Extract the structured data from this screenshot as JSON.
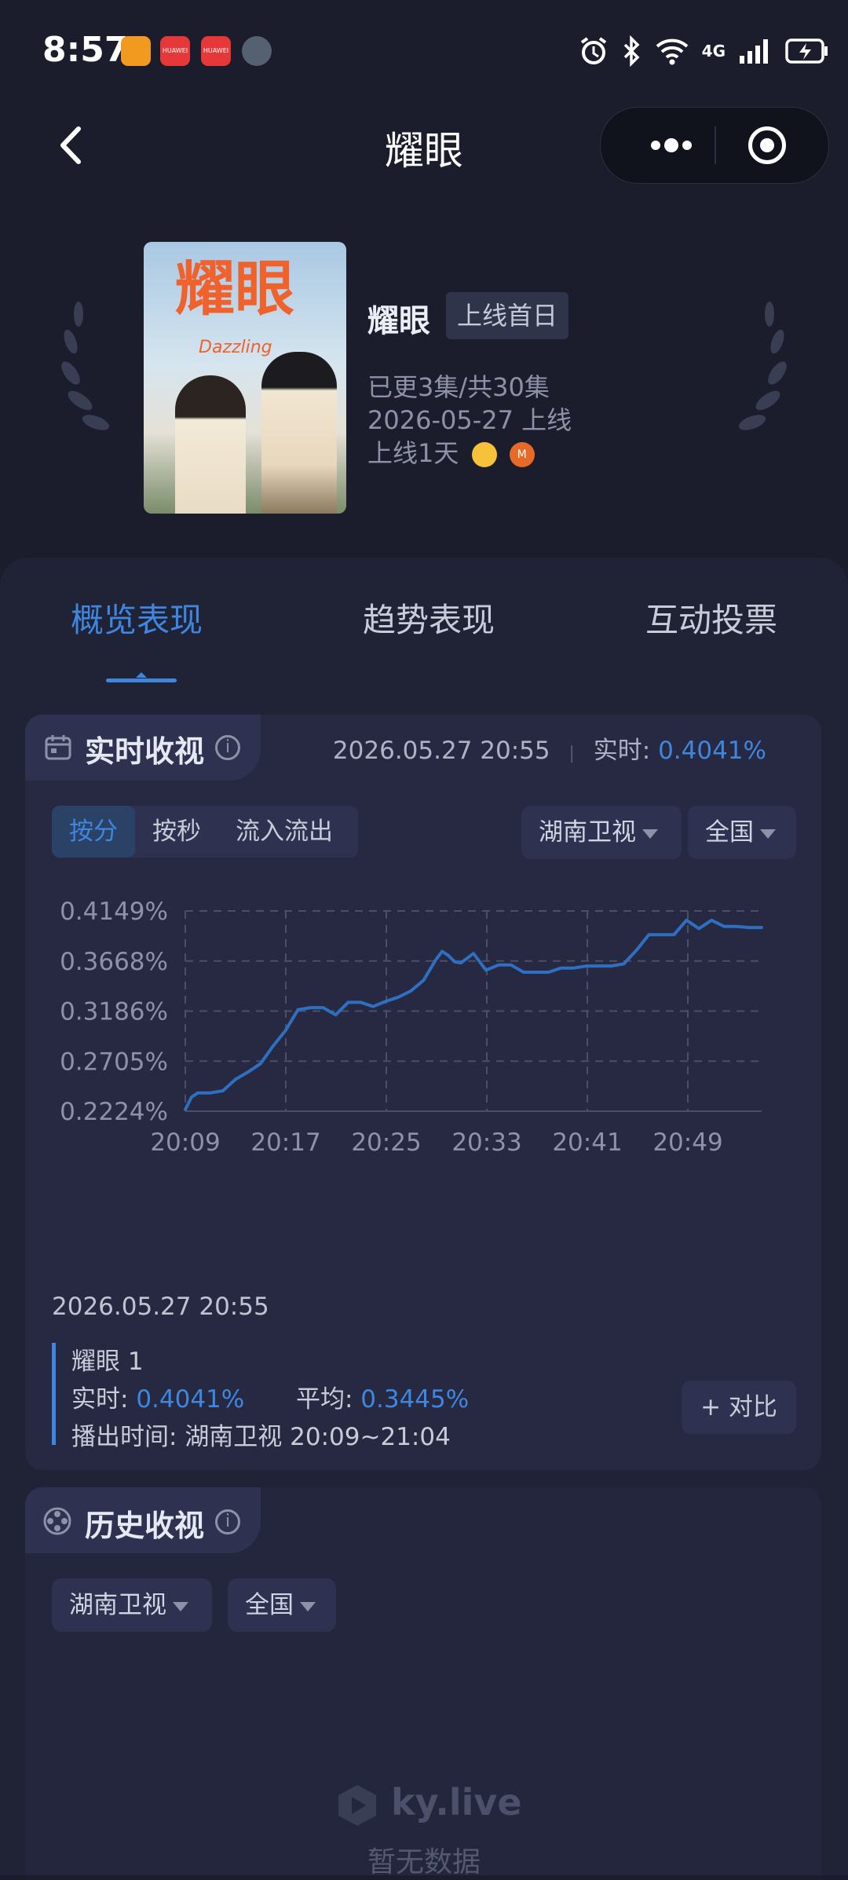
{
  "status_bar": {
    "time": "8:57",
    "apps": [
      {
        "icon": "taobao-app-icon",
        "color": "#f29a20",
        "label": ""
      },
      {
        "icon": "huawei-app-icon",
        "color": "#e63838",
        "label": "HUAWEI"
      },
      {
        "icon": "huawei-app-icon-2",
        "color": "#e63838",
        "label": "HUAWEI"
      },
      {
        "icon": "avatar-app-icon",
        "color": "#556070",
        "label": ""
      }
    ],
    "network": "4G"
  },
  "nav": {
    "title": "耀眼"
  },
  "show": {
    "title": "耀眼",
    "badge": "上线首日",
    "episodes": "已更3集/共30集",
    "air_date": "2026-05-27 上线",
    "days_online": "上线1天",
    "poster_title": "耀眼",
    "poster_subtitle": "Dazzling"
  },
  "tabs": [
    {
      "label": "概览表现",
      "active": true
    },
    {
      "label": "趋势表现",
      "active": false
    },
    {
      "label": "互动投票",
      "active": false
    }
  ],
  "realtime": {
    "title": "实时收视",
    "info": "i",
    "timestamp": "2026.05.27 20:55",
    "live_label": "实时:",
    "live_value": "0.4041%",
    "modes": [
      "按分",
      "按秒",
      "流入流出"
    ],
    "channel": "湖南卫视",
    "region": "全国"
  },
  "chart_data": {
    "type": "line",
    "y_ticks": [
      "0.4149%",
      "0.3668%",
      "0.3186%",
      "0.2705%",
      "0.2224%"
    ],
    "x_ticks": [
      "20:09",
      "20:17",
      "20:25",
      "20:33",
      "20:41",
      "20:49"
    ],
    "ylim": [
      0.2224,
      0.4149
    ],
    "xlim_minutes": [
      0,
      46
    ],
    "grid": true,
    "color": "#2f6fc2",
    "series": [
      {
        "x": [
          0,
          0.5,
          1,
          2,
          3,
          4,
          5,
          6,
          7,
          8,
          9,
          10,
          11,
          12,
          13,
          14,
          15,
          16,
          17,
          18,
          19,
          20,
          20.5,
          21,
          21.5,
          22,
          23,
          24,
          25,
          26,
          27,
          28,
          29,
          30,
          31,
          32,
          33,
          34,
          35,
          36,
          37,
          38,
          39,
          40,
          41,
          42,
          43,
          44,
          45,
          46
        ],
        "y": [
          0.224,
          0.236,
          0.24,
          0.24,
          0.242,
          0.253,
          0.26,
          0.268,
          0.285,
          0.3,
          0.32,
          0.322,
          0.322,
          0.315,
          0.327,
          0.327,
          0.323,
          0.328,
          0.332,
          0.338,
          0.348,
          0.368,
          0.376,
          0.372,
          0.366,
          0.365,
          0.374,
          0.358,
          0.363,
          0.363,
          0.356,
          0.356,
          0.356,
          0.36,
          0.36,
          0.362,
          0.362,
          0.362,
          0.364,
          0.377,
          0.392,
          0.392,
          0.392,
          0.406,
          0.398,
          0.406,
          0.4,
          0.4,
          0.399,
          0.399
        ]
      }
    ]
  },
  "legend": {
    "date": "2026.05.27 20:55",
    "series_name": "耀眼 1",
    "live_label": "实时:",
    "live_value": "0.4041%",
    "avg_label": "平均:",
    "avg_value": "0.3445%",
    "air_label": "播出时间:",
    "air_value": "湖南卫视 20:09~21:04",
    "compare": "+ 对比"
  },
  "history": {
    "title": "历史收视",
    "info": "i",
    "channel": "湖南卫视",
    "region": "全国",
    "brand": "ky.live",
    "empty": "暂无数据"
  }
}
